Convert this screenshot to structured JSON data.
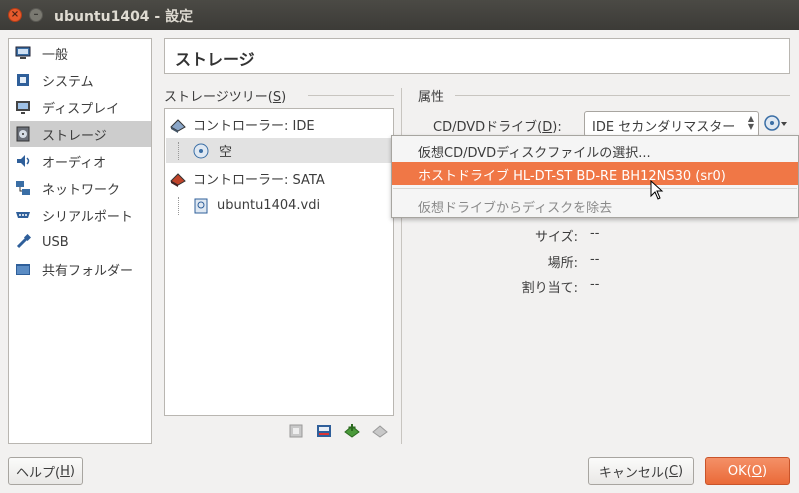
{
  "window": {
    "title": "ubuntu1404 - 設定",
    "close_glyph": "×",
    "minimize_glyph": "–"
  },
  "sidebar": {
    "items": [
      {
        "label": "一般",
        "icon": "monitor-icon"
      },
      {
        "label": "システム",
        "icon": "chip-icon"
      },
      {
        "label": "ディスプレイ",
        "icon": "display-icon"
      },
      {
        "label": "ストレージ",
        "icon": "storage-icon",
        "selected": true
      },
      {
        "label": "オーディオ",
        "icon": "speaker-icon"
      },
      {
        "label": "ネットワーク",
        "icon": "network-icon"
      },
      {
        "label": "シリアルポート",
        "icon": "serial-port-icon"
      },
      {
        "label": "USB",
        "icon": "usb-icon"
      },
      {
        "label": "共有フォルダー",
        "icon": "folder-icon"
      }
    ]
  },
  "page": {
    "title": "ストレージ"
  },
  "tree": {
    "label_pre": "ストレージツリー(",
    "label_key": "S",
    "label_post": ")",
    "nodes": [
      {
        "label": "コントローラー: IDE",
        "icon": "ide-controller-icon"
      },
      {
        "label": "空",
        "icon": "optical-disc-icon",
        "selected": true
      },
      {
        "label": "コントローラー: SATA",
        "icon": "sata-controller-icon"
      },
      {
        "label": "ubuntu1404.vdi",
        "icon": "hard-disk-icon"
      }
    ]
  },
  "attributes": {
    "label": "属性",
    "cd_label_pre": "CD/DVDドライブ(",
    "cd_label_key": "D",
    "cd_label_post": "):",
    "cd_value": "IDE セカンダリマスター",
    "menu": [
      {
        "label": "仮想CD/DVDディスクファイルの選択...",
        "state": "normal"
      },
      {
        "label": "ホストドライブ HL-DT-ST BD-RE  BH12NS30  (sr0)",
        "state": "highlighted"
      },
      {
        "label": "仮想ドライブからディスクを除去",
        "state": "disabled"
      }
    ]
  },
  "information": {
    "size_label": "サイズ:",
    "size_value": "--",
    "location_label": "場所:",
    "location_value": "--",
    "attached_label": "割り当て:",
    "attached_value": "--"
  },
  "buttons": {
    "help_pre": "ヘルプ(",
    "help_key": "H",
    "help_post": ")",
    "cancel_pre": "キャンセル(",
    "cancel_key": "C",
    "cancel_post": ")",
    "ok_pre": "OK(",
    "ok_key": "O",
    "ok_post": ")"
  },
  "colors": {
    "accent": "#f07746",
    "titlebar": "#3c3b37",
    "ok_button": "#ea6a38"
  }
}
